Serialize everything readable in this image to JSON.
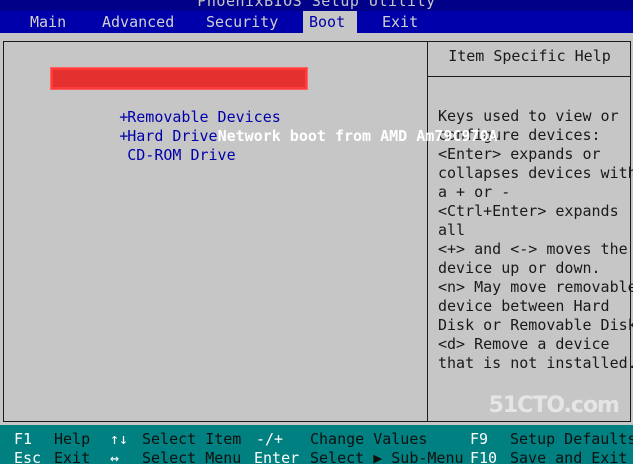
{
  "title": "PhoenixBIOS Setup Utility",
  "menu": [
    {
      "label": "Main",
      "active": false
    },
    {
      "label": "Advanced",
      "active": false
    },
    {
      "label": "Security",
      "active": false
    },
    {
      "label": "Boot",
      "active": true
    },
    {
      "label": "Exit",
      "active": false
    }
  ],
  "boot_items": [
    {
      "prefix": " ",
      "label": "Network boot from AMD Am79C970A",
      "selected": true
    },
    {
      "prefix": "+",
      "label": "Removable Devices",
      "selected": false
    },
    {
      "prefix": "+",
      "label": "Hard Drive",
      "selected": false
    },
    {
      "prefix": " ",
      "label": "CD-ROM Drive",
      "selected": false
    }
  ],
  "help": {
    "title": "Item Specific Help",
    "lines": [
      "Keys used to view or",
      "configure devices:",
      "<Enter> expands or",
      "collapses devices with",
      "a + or -",
      "<Ctrl+Enter> expands",
      "all",
      "<+> and <-> moves the",
      "device up or down.",
      "<n> May move removable",
      "device between Hard",
      "Disk or Removable Disk",
      "<d> Remove a device",
      "that is not installed."
    ]
  },
  "footer": {
    "row1": [
      {
        "key": "F1",
        "desc": "Help"
      },
      {
        "key": "↑↓",
        "desc": "Select Item"
      },
      {
        "key": "-/+",
        "desc": "Change Values"
      },
      {
        "key": "F9",
        "desc": "Setup Defaults"
      }
    ],
    "row2": [
      {
        "key": "Esc",
        "desc": "Exit"
      },
      {
        "key": "↔",
        "desc": "Select Menu"
      },
      {
        "key": "Enter",
        "desc": "Select ▶ Sub-Menu"
      },
      {
        "key": "F10",
        "desc": "Save and Exit"
      }
    ]
  },
  "watermark": "51CTO.com",
  "colors": {
    "menubar_bg": "#0000aa",
    "panel_bg": "#c6c6c6",
    "footer_bg": "#008080",
    "highlight_border": "#e53030"
  }
}
